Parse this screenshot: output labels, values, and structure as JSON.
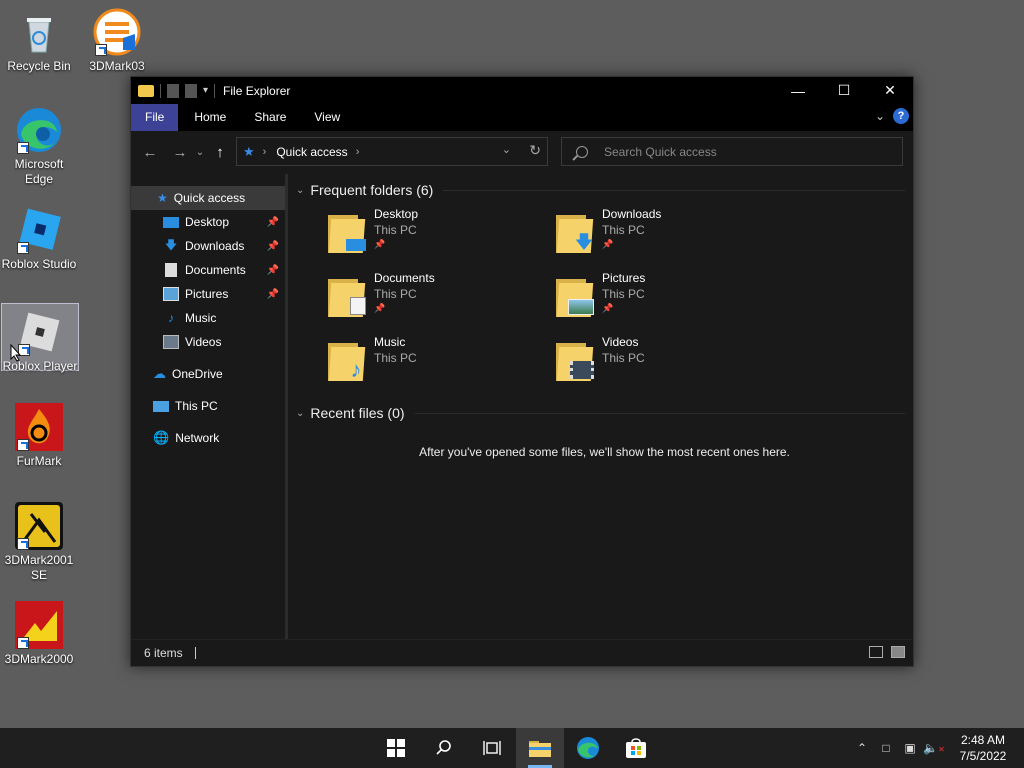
{
  "desktop_icons": [
    {
      "label": "Recycle Bin",
      "icon": "recycle-bin-icon"
    },
    {
      "label": "3DMark03",
      "icon": "3dmark03-icon"
    },
    {
      "label": "Microsoft Edge",
      "icon": "edge-icon"
    },
    {
      "label": "Roblox Studio",
      "icon": "roblox-studio-icon"
    },
    {
      "label": "Roblox Player",
      "icon": "roblox-player-icon"
    },
    {
      "label": "FurMark",
      "icon": "furmark-icon"
    },
    {
      "label": "3DMark2001 SE",
      "icon": "3dmark2001-icon"
    },
    {
      "label": "3DMark2000",
      "icon": "3dmark2000-icon"
    }
  ],
  "window": {
    "title": "File Explorer",
    "ribbon_tabs": [
      "File",
      "Home",
      "Share",
      "View"
    ],
    "address": {
      "crumb": "Quick access"
    },
    "search": {
      "placeholder": "Search Quick access"
    }
  },
  "navpane": {
    "items": [
      {
        "label": "Quick access",
        "icon": "star-icon",
        "pinned": false
      },
      {
        "label": "Desktop",
        "icon": "desktop-icon",
        "pinned": true
      },
      {
        "label": "Downloads",
        "icon": "download-icon",
        "pinned": true
      },
      {
        "label": "Documents",
        "icon": "document-icon",
        "pinned": true
      },
      {
        "label": "Pictures",
        "icon": "picture-icon",
        "pinned": true
      },
      {
        "label": "Music",
        "icon": "music-icon",
        "pinned": false
      },
      {
        "label": "Videos",
        "icon": "video-icon",
        "pinned": false
      },
      {
        "label": "OneDrive",
        "icon": "cloud-icon",
        "pinned": false
      },
      {
        "label": "This PC",
        "icon": "pc-icon",
        "pinned": false
      },
      {
        "label": "Network",
        "icon": "network-icon",
        "pinned": false
      }
    ]
  },
  "content": {
    "frequent_header": "Frequent folders (6)",
    "folders": [
      {
        "name": "Desktop",
        "location": "This PC",
        "pinned": true
      },
      {
        "name": "Downloads",
        "location": "This PC",
        "pinned": true
      },
      {
        "name": "Documents",
        "location": "This PC",
        "pinned": true
      },
      {
        "name": "Pictures",
        "location": "This PC",
        "pinned": true
      },
      {
        "name": "Music",
        "location": "This PC",
        "pinned": false
      },
      {
        "name": "Videos",
        "location": "This PC",
        "pinned": false
      }
    ],
    "recent_header": "Recent files (0)",
    "recent_empty": "After you've opened some files, we'll show the most recent ones here."
  },
  "statusbar": {
    "count": "6 items"
  },
  "taskbar": {
    "time": "2:48 AM",
    "date": "7/5/2022"
  },
  "colors": {
    "accent": "#3d4296",
    "folder": "#f5d36a",
    "edge_blue": "#1a8ad8"
  }
}
